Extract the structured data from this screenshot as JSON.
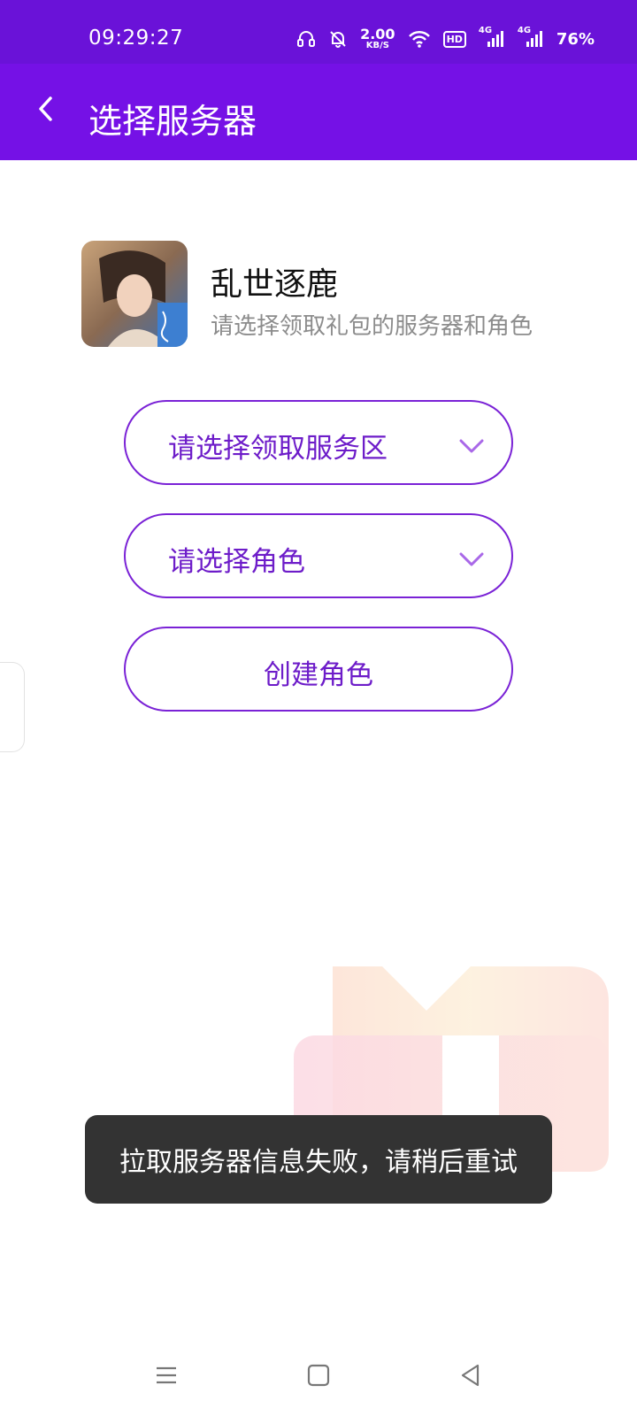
{
  "status_bar": {
    "time": "09:29:27",
    "net_speed_value": "2.00",
    "net_speed_unit": "KB/S",
    "hd_label": "HD",
    "signal_1_label": "4G",
    "signal_2_label": "4G",
    "battery": "76%"
  },
  "app_bar": {
    "title": "选择服务器"
  },
  "game": {
    "name": "乱世逐鹿",
    "subtitle": "请选择领取礼包的服务器和角色"
  },
  "selectors": {
    "server_placeholder": "请选择领取服务区",
    "role_placeholder": "请选择角色",
    "create_role_label": "创建角色"
  },
  "toast": {
    "message": "拉取服务器信息失败，请稍后重试"
  },
  "colors": {
    "status_bar_bg": "#6a12d8",
    "app_bar_bg": "#7511e6",
    "accent": "#7a22d6",
    "toast_bg": "#333333"
  },
  "icons": {
    "back": "chevron-left-icon",
    "dropdown": "chevron-down-icon",
    "nav_menu": "menu-icon",
    "nav_home": "home-icon",
    "nav_back": "triangle-back-icon"
  }
}
